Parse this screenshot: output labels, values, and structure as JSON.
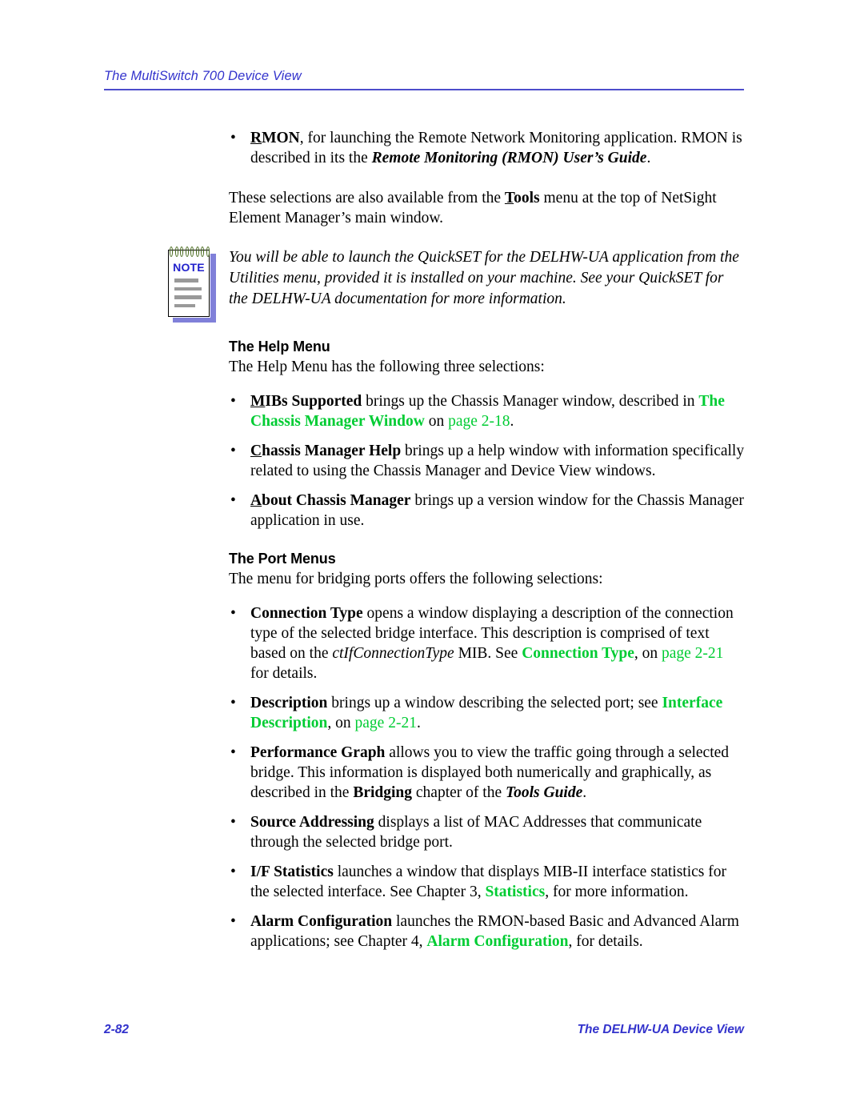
{
  "header": {
    "title": "The MultiSwitch 700 Device View"
  },
  "footer": {
    "page_number": "2-82",
    "title": "The DELHW-UA Device View"
  },
  "body": {
    "rmon_bullet": {
      "term": "RMON",
      "term_accelerator": "R",
      "text_1": ", for launching the Remote Network Monitoring application. RMON is described in its the ",
      "italic_ref": "Remote Monitoring (RMON) User’s Guide",
      "text_2": "."
    },
    "tools_paragraph": {
      "text_1": "These selections are also available from the ",
      "bold_term": "Tools",
      "bold_accelerator": "T",
      "text_2": " menu at the top of NetSight Element Manager’s main window."
    },
    "note": {
      "label": "NOTE",
      "text": "You will be able to launch the QuickSET for the DELHW-UA application from the Utilities menu, provided it is installed on your machine. See your QuickSET for the DELHW-UA documentation for more information."
    },
    "help_menu": {
      "heading": "The Help Menu",
      "intro": "The Help Menu has the following three selections:",
      "bullets": [
        {
          "term": "MIBs Supported",
          "accelerator": "M",
          "text_1": " brings up the Chassis Manager window, described in ",
          "xref": "The Chassis Manager Window",
          "text_2": " on ",
          "xref_page": "page 2-18",
          "text_3": "."
        },
        {
          "term": "Chassis Manager Help",
          "accelerator": "C",
          "text_1": " brings up a help window with information specifically related to using the Chassis Manager and Device View windows."
        },
        {
          "term": "About Chassis Manager",
          "accelerator": "A",
          "text_1": " brings up a version window for the Chassis Manager application in use."
        }
      ]
    },
    "port_menus": {
      "heading": "The Port Menus",
      "intro": "The menu for bridging ports offers the following selections:",
      "bullets": [
        {
          "term": "Connection Type",
          "text_1": " opens a window displaying a description of the connection type of the selected bridge interface. This description is comprised of text based on the ",
          "italic_term": "ctIfConnectionType",
          "text_2": " MIB. See ",
          "xref": "Connection Type",
          "text_3": ", on ",
          "xref_page": "page 2-21",
          "text_4": " for details."
        },
        {
          "term": "Description",
          "text_1": " brings up a window describing the selected port; see ",
          "xref": "Interface Description",
          "text_2": ", on ",
          "xref_page": "page 2-21",
          "text_3": "."
        },
        {
          "term": "Performance Graph",
          "text_1": " allows you to view the traffic going through a selected bridge. This information is displayed both numerically and graphically, as described in the ",
          "bold_term": "Bridging",
          "text_2": " chapter of the ",
          "bold_italic_term": "Tools Guide",
          "text_3": "."
        },
        {
          "term": "Source Addressing",
          "text_1": " displays a list of MAC Addresses that communicate through the selected bridge port."
        },
        {
          "term": "I/F Statistics",
          "text_1": " launches a window that displays MIB-II interface statistics for the selected interface. See Chapter 3, ",
          "xref": "Statistics",
          "text_2": ", for more information."
        },
        {
          "term": "Alarm Configuration",
          "text_1": " launches the RMON-based Basic and Advanced Alarm applications; see Chapter 4, ",
          "xref": "Alarm Configuration",
          "text_2": ", for details."
        }
      ]
    }
  },
  "colors": {
    "header_blue": "#3333CC",
    "xref_green": "#00CC33",
    "note_shadow": "#8080D9",
    "note_label_blue": "#2222CC"
  }
}
